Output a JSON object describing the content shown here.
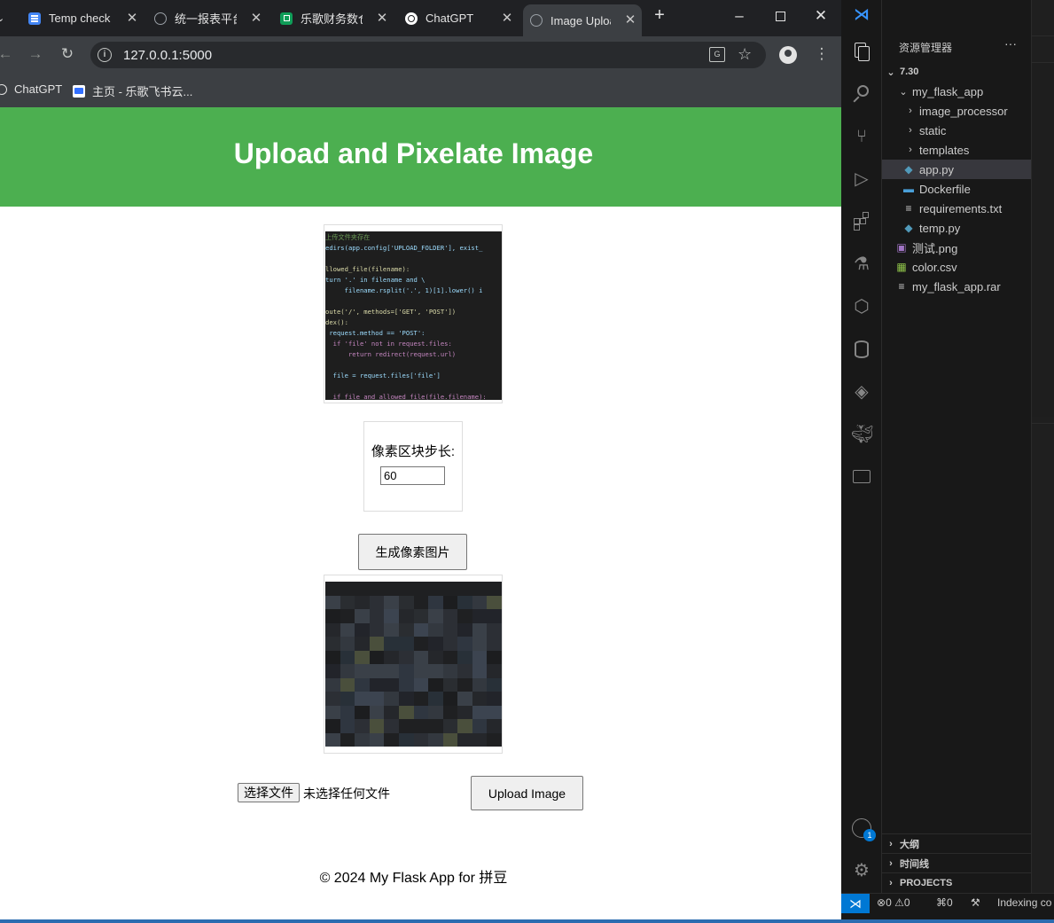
{
  "browser": {
    "tabs": [
      {
        "label": "Temp check",
        "icon": "docs-icon",
        "color": "#4285f4"
      },
      {
        "label": "统一报表平台",
        "icon": "globe-icon",
        "color": "#9aa0a6"
      },
      {
        "label": "乐歌财务数仓",
        "icon": "sheets-icon",
        "color": "#0f9d58"
      },
      {
        "label": "ChatGPT",
        "icon": "chatgpt-icon",
        "color": "#ffffff"
      },
      {
        "label": "Image Upload",
        "icon": "globe-icon",
        "color": "#9aa0a6",
        "active": true
      }
    ],
    "new_tab": "+",
    "url": "127.0.0.1:5000",
    "bookmarks": [
      {
        "label": "ChatGPT",
        "icon": "chatgpt-icon"
      },
      {
        "label": "主页 - 乐歌飞书云...",
        "icon": "feishu-icon"
      }
    ]
  },
  "page": {
    "title": "Upload and Pixelate Image",
    "original_image_code": [
      "上传文件夹存在",
      "edirs(app.config['UPLOAD_FOLDER'], exist_",
      "",
      "llowed_file(filename):",
      "turn '.' in filename and \\",
      "     filename.rsplit('.', 1)[1].lower() i",
      "",
      "oute('/', methods=['GET', 'POST'])",
      "dex():",
      " request.method == 'POST':",
      "  if 'file' not in request.files:",
      "      return redirect(request.url)",
      "",
      "  file = request.files['file']",
      "",
      "  if file and allowed_file(file.filename):"
    ],
    "step_label": "像素区块步长:",
    "step_value": "60",
    "generate_button": "生成像素图片",
    "choose_file_button": "选择文件",
    "no_file_text": "未选择任何文件",
    "upload_button": "Upload Image",
    "footer": "© 2024 My Flask App for 拼豆"
  },
  "vscode": {
    "explorer_title": "资源管理器",
    "tree": [
      {
        "label": "7.30",
        "type": "folder-open",
        "depth": 0,
        "bold": true
      },
      {
        "label": "my_flask_app",
        "type": "folder-open",
        "depth": 1
      },
      {
        "label": "image_processor",
        "type": "folder",
        "depth": 2
      },
      {
        "label": "static",
        "type": "folder",
        "depth": 2
      },
      {
        "label": "templates",
        "type": "folder",
        "depth": 2
      },
      {
        "label": "app.py",
        "type": "python",
        "depth": 2,
        "selected": true
      },
      {
        "label": "Dockerfile",
        "type": "docker",
        "depth": 2
      },
      {
        "label": "requirements.txt",
        "type": "text",
        "depth": 2
      },
      {
        "label": "temp.py",
        "type": "python",
        "depth": 2
      },
      {
        "label": "测试.png",
        "type": "image",
        "depth": 1
      },
      {
        "label": "color.csv",
        "type": "csv",
        "depth": 1
      },
      {
        "label": "my_flask_app.rar",
        "type": "text",
        "depth": 1
      }
    ],
    "panels": [
      "大纲",
      "时间线",
      "PROJECTS"
    ],
    "status": {
      "errors": "0",
      "warnings": "0",
      "ports": "0",
      "indexing": "Indexing co"
    },
    "accounts_badge": "1"
  },
  "colors": {
    "header_green": "#4caf50",
    "vscode_accent": "#0078d4",
    "python_blue": "#519aba"
  }
}
